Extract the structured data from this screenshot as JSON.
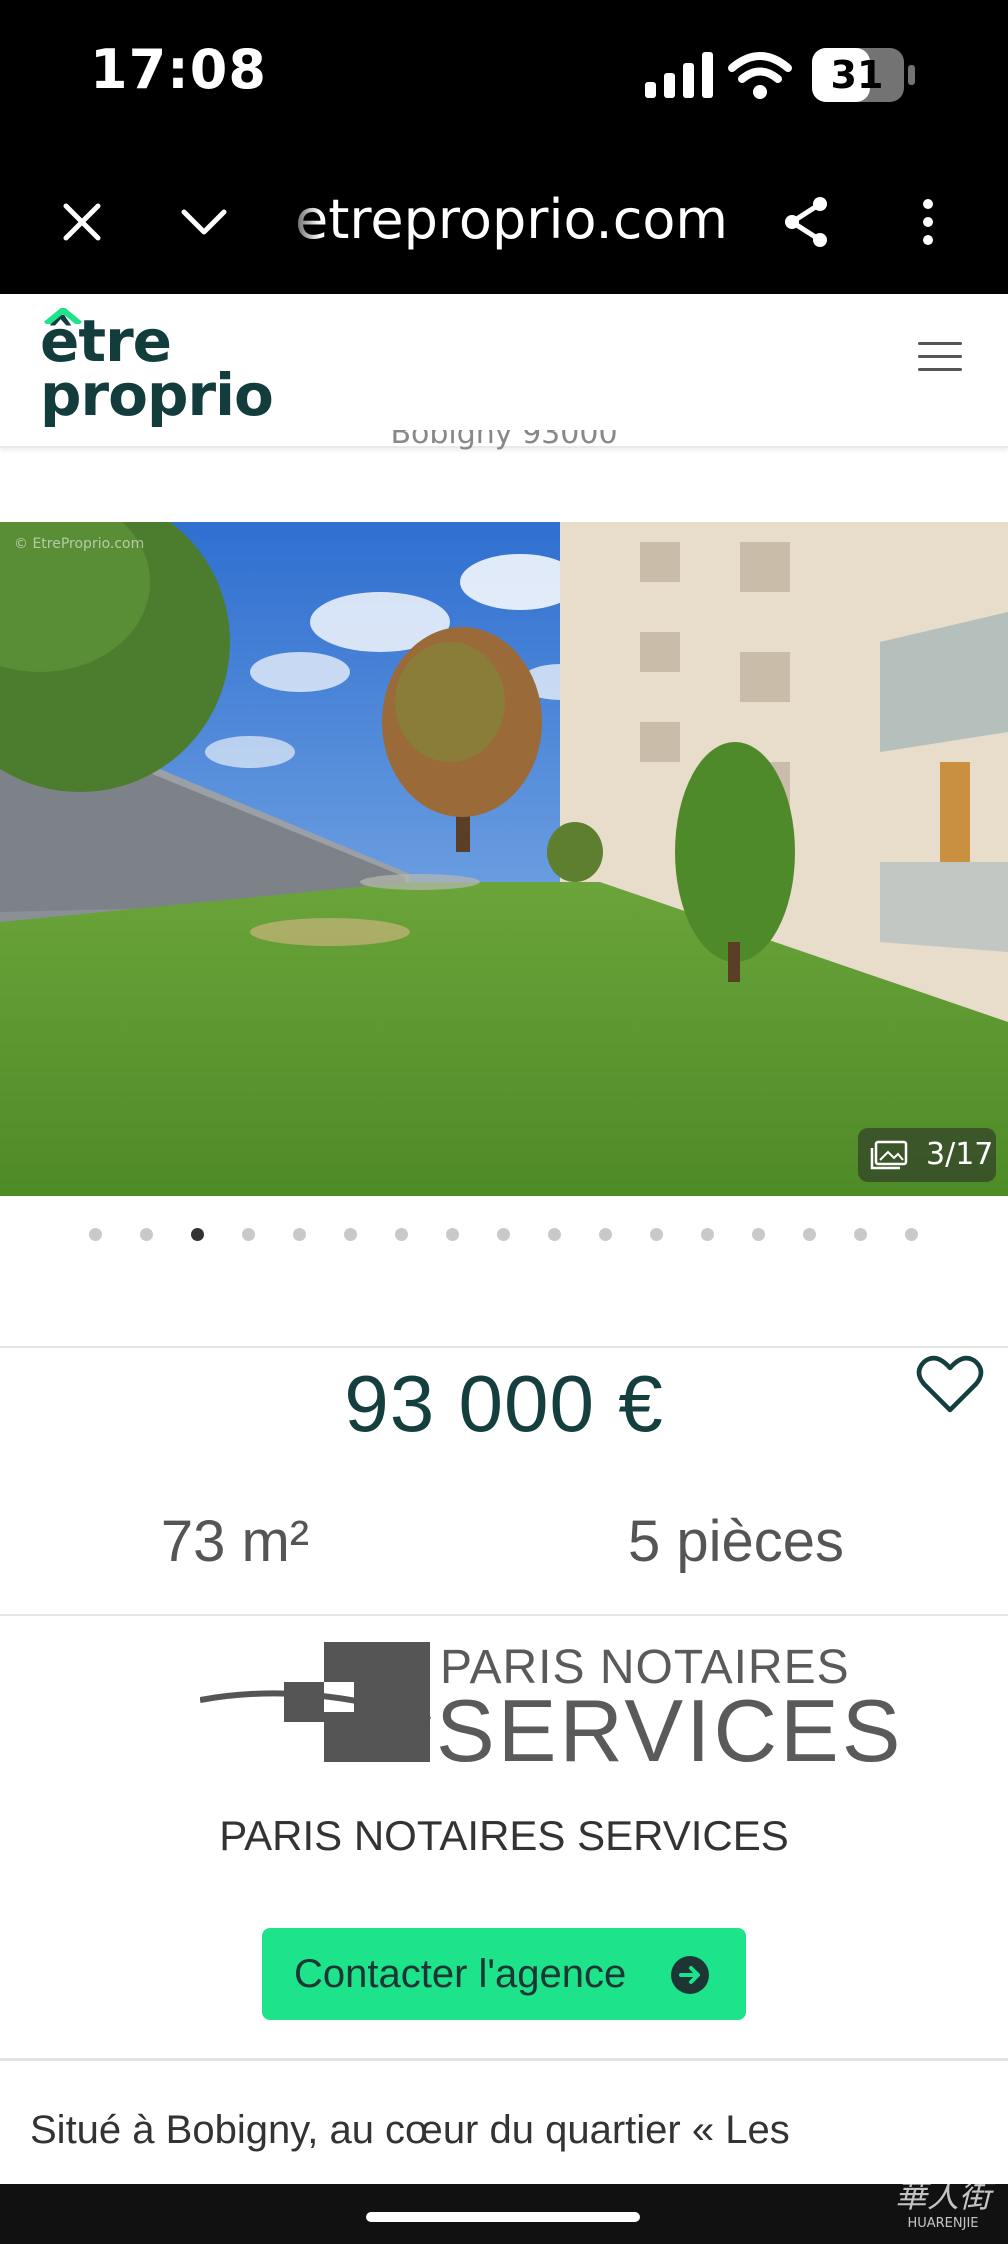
{
  "status_bar": {
    "time": "17:08",
    "battery": "31"
  },
  "browser": {
    "url": "etreproprio.com"
  },
  "site": {
    "logo_line1": "être",
    "logo_line2": "proprio"
  },
  "listing": {
    "location_partial": "Bobigny 93000",
    "photo_counter": "3/17",
    "watermark": "© EtreProprio.com",
    "current_photo": 3,
    "total_photos": 17,
    "price": "93 000 €",
    "surface": "73 m²",
    "rooms": "5 pièces"
  },
  "agency": {
    "logo_line1": "PARIS NOTAIRES",
    "logo_line2": "SERVICES",
    "name": "PARIS NOTAIRES SERVICES",
    "contact_label": "Contacter l'agence"
  },
  "description": {
    "text": "Situé à Bobigny, au cœur du quartier « Les"
  },
  "overlay_watermark": {
    "cn": "華人街",
    "en": "HUARENJIE"
  },
  "colors": {
    "brand_dark": "#153e3e",
    "brand_green": "#1de38a"
  }
}
